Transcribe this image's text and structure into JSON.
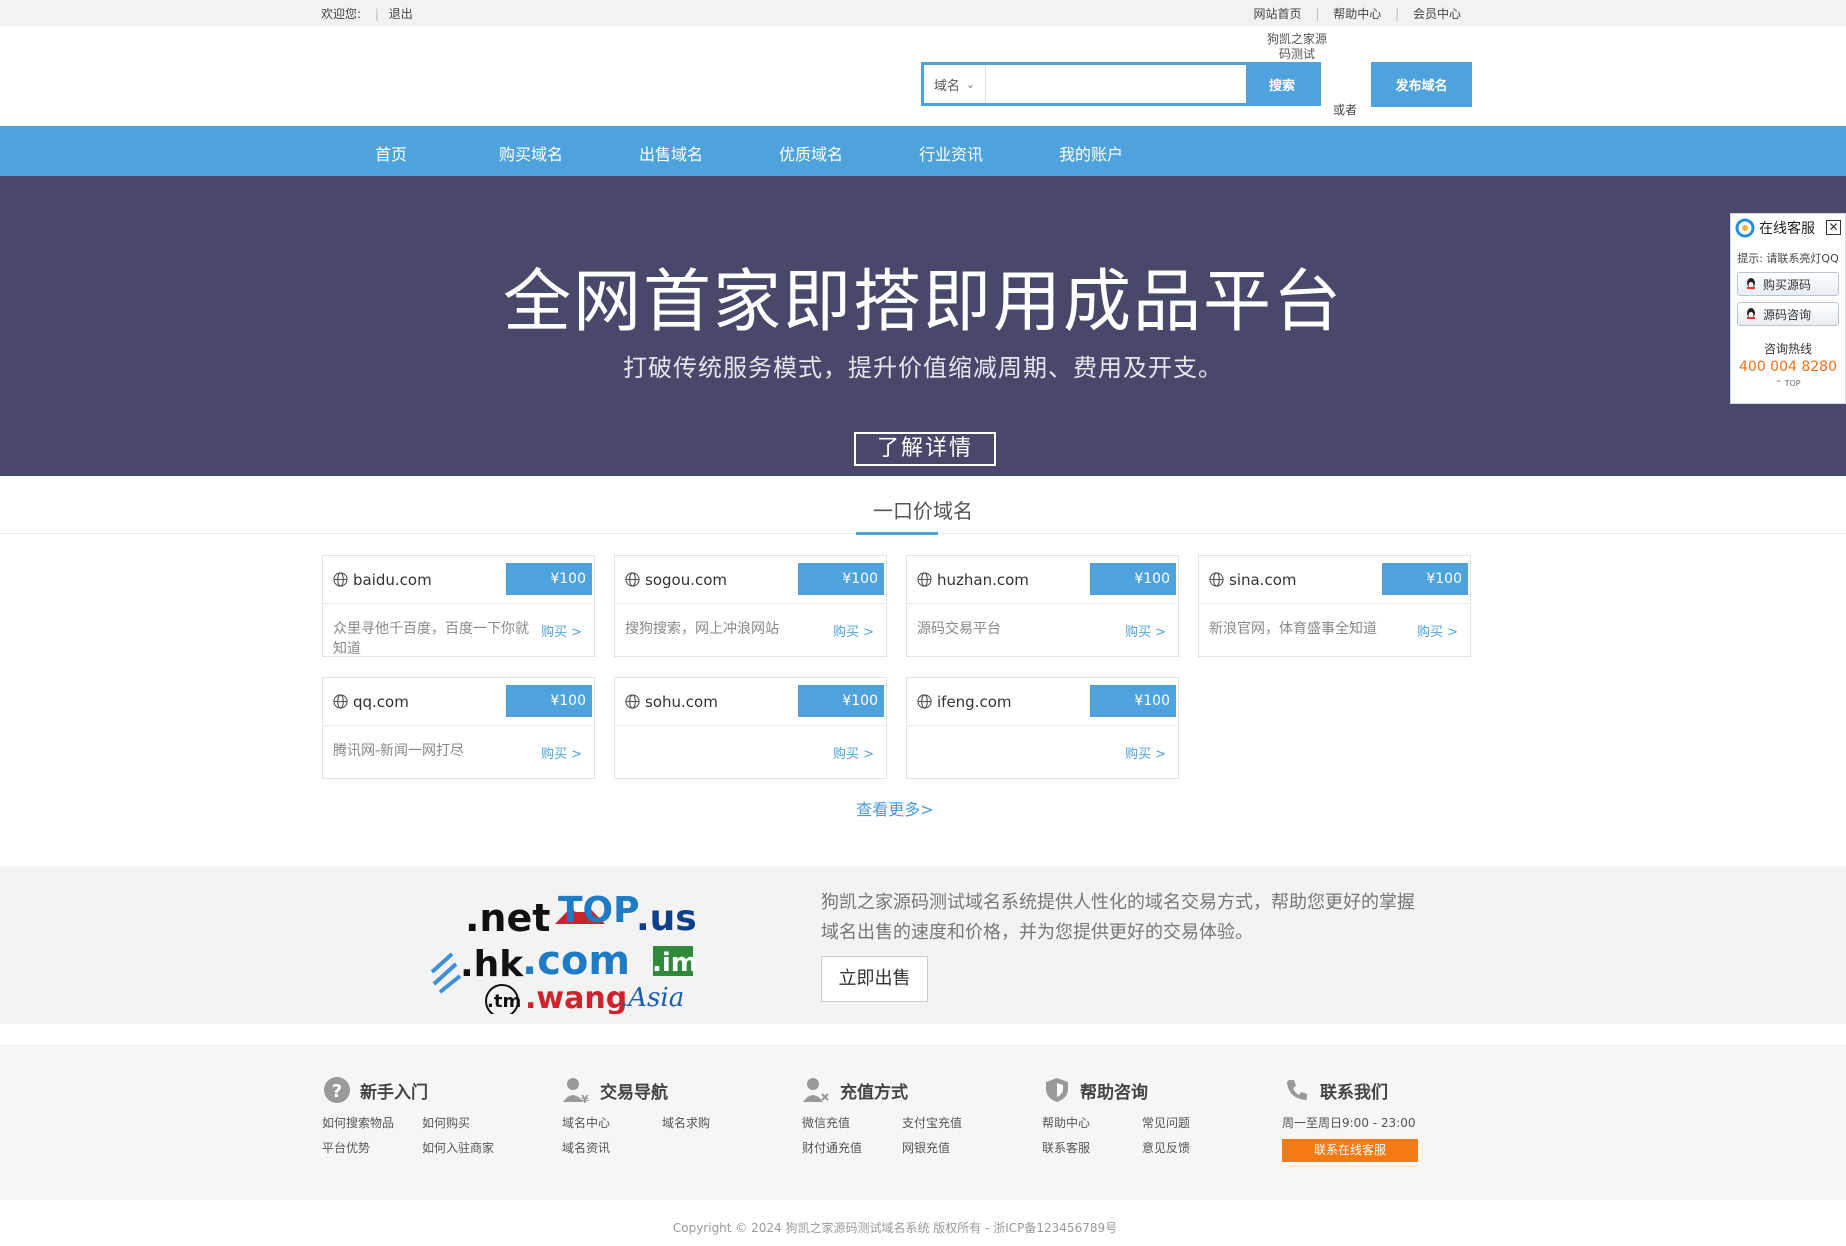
{
  "topbar": {
    "welcome": "欢迎您:",
    "logout": "退出",
    "links": [
      "网站首页",
      "帮助中心",
      "会员中心"
    ]
  },
  "header": {
    "site_name": "狗凯之家源码测试",
    "search_type": "域名",
    "search_value": "",
    "search_button": "搜索",
    "or_text": "或者",
    "publish_button": "发布域名"
  },
  "nav": [
    "首页",
    "购买域名",
    "出售域名",
    "优质域名",
    "行业资讯",
    "我的账户"
  ],
  "banner": {
    "title": "全网首家即搭即用成品平台",
    "subtitle": "打破传统服务模式，提升价值缩减周期、费用及开支。",
    "button": "了解详情"
  },
  "section_title": "一口价域名",
  "domains": [
    {
      "name": "baidu.com",
      "price": "¥100",
      "desc": "众里寻他千百度，百度一下你就知道",
      "buy": "购买 >"
    },
    {
      "name": "sogou.com",
      "price": "¥100",
      "desc": "搜狗搜索，网上冲浪网站",
      "buy": "购买 >"
    },
    {
      "name": "huzhan.com",
      "price": "¥100",
      "desc": "源码交易平台",
      "buy": "购买 >"
    },
    {
      "name": "sina.com",
      "price": "¥100",
      "desc": "新浪官网，体育盛事全知道",
      "buy": "购买 >"
    },
    {
      "name": "qq.com",
      "price": "¥100",
      "desc": "腾讯网-新闻一网打尽",
      "buy": "购买 >"
    },
    {
      "name": "sohu.com",
      "price": "¥100",
      "desc": "",
      "buy": "购买 >"
    },
    {
      "name": "ifeng.com",
      "price": "¥100",
      "desc": "",
      "buy": "购买 >"
    }
  ],
  "more_link": "查看更多>",
  "promo": {
    "logo_text": {
      "net": ".net",
      "top": "TOP",
      "us": ".us",
      "hk": ".hk",
      "com": ".com",
      "im": ".im",
      "tm": ".tm",
      "wang": ".wang",
      "asia": ".Asia"
    },
    "text": "狗凯之家源码测试域名系统提供人性化的域名交易方式，帮助您更好的掌握域名出售的速度和价格，并为您提供更好的交易体验。",
    "button": "立即出售"
  },
  "footer": {
    "cols": [
      {
        "title": "新手入门",
        "links": [
          "如何搜索物品",
          "如何购买",
          "平台优势",
          "如何入驻商家"
        ]
      },
      {
        "title": "交易导航",
        "links": [
          "域名中心",
          "域名求购",
          "域名资讯"
        ]
      },
      {
        "title": "充值方式",
        "links": [
          "微信充值",
          "支付宝充值",
          "财付通充值",
          "网银充值"
        ]
      },
      {
        "title": "帮助咨询",
        "links": [
          "帮助中心",
          "常见问题",
          "联系客服",
          "意见反馈"
        ]
      }
    ],
    "contact": {
      "title": "联系我们",
      "hours": "周一至周日9:00 - 23:00",
      "button": "联系在线客服"
    }
  },
  "copyright": "Copyright © 2024 狗凯之家源码测试域名系统 版权所有 - 浙ICP备123456789号",
  "service": {
    "title": "在线客服",
    "tip": "提示: 请联系亮灯QQ",
    "buttons": [
      "购买源码",
      "源码咨询"
    ],
    "hotline_label": "咨询热线",
    "phone": "400 004 8280",
    "top": "TOP"
  }
}
